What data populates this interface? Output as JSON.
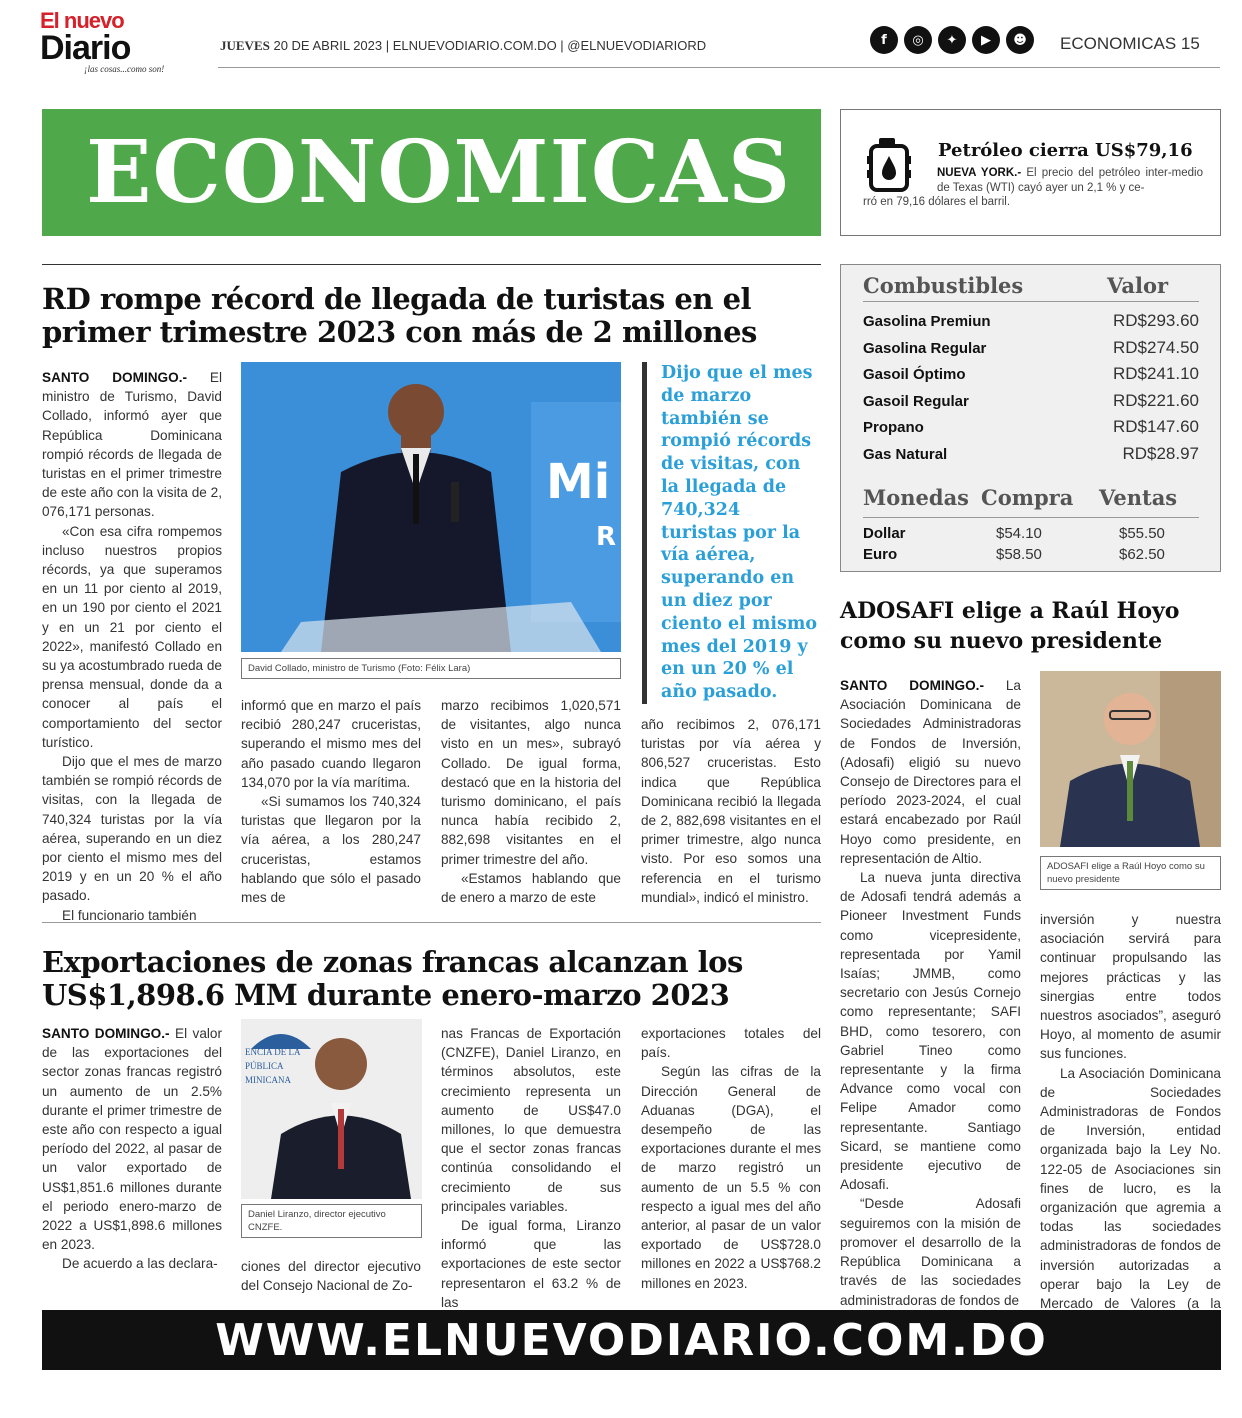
{
  "masthead": {
    "logo_line1": "El nuevo",
    "logo_line2": "Diario",
    "logo_tagline": "¡las cosas...como son!",
    "day": "JUEVES",
    "dateline": " 20 DE ABRIL 2023 | ELNUEVODIARIO.COM.DO | @ELNUEVODIARIORD",
    "section": "ECONOMICAS 15",
    "social_icons": [
      "facebook-icon",
      "instagram-icon",
      "twitter-icon",
      "youtube-icon",
      "snapchat-icon"
    ]
  },
  "banner": {
    "title": "ECONOMICAS",
    "color": "#4fa84a"
  },
  "oil": {
    "headline": "Petróleo cierra US$79,16",
    "dateline": "NUEVA YORK.-",
    "body_a": "El precio del petróleo inter-medio de Texas (WTI) cayó ayer un 2,1 % y ce-",
    "body_b": "rró en 79,16 dólares el barril."
  },
  "fuel": {
    "header_name": "Combustibles",
    "header_value": "Valor",
    "items": [
      {
        "name": "Gasolina Premiun",
        "value": "RD$293.60"
      },
      {
        "name": "Gasolina Regular",
        "value": "RD$274.50"
      },
      {
        "name": "Gasoil Óptimo",
        "value": "RD$241.10"
      },
      {
        "name": "Gasoil Regular",
        "value": "RD$221.60"
      },
      {
        "name": "Propano",
        "value": "RD$147.60"
      },
      {
        "name": "Gas Natural",
        "value": "RD$28.97"
      }
    ],
    "currency_header": "Monedas",
    "buy_header": "Compra",
    "sell_header": "Ventas",
    "currencies": [
      {
        "name": "Dollar",
        "buy": "$54.10",
        "sell": "$55.50"
      },
      {
        "name": "Euro",
        "buy": "$58.50",
        "sell": "$62.50"
      }
    ]
  },
  "article1": {
    "headline_1": "RD rompe récord de llegada de turistas en el",
    "headline_2": "primer trimestre 2023 con más de 2 millones",
    "lead": "SANTO DOMINGO.-",
    "col1": "El ministro de Turismo, David Collado, informó ayer que República Dominicana rompió récords de llegada de turistas en el primer trimestre de este año con la visita de 2, 076,171 personas.\n«Con esa cifra rompemos incluso nuestros propios récords, ya que superamos en un 11 por ciento al 2019, en un 190 por ciento el 2021 y en un 21 por ciento el 2022», manifestó Collado en su ya acostumbrado rueda de prensa mensual, donde da a conocer al país el comportamiento del sector turístico.\nDijo que el mes de marzo también se rompió récords de visitas, con la llegada de 740,324 turistas por la vía aérea, superando en un diez por ciento el mismo mes del 2019 y en un 20 % el año pasado.\nEl funcionario también",
    "col2": "informó que en marzo el país recibió 280,247 cruceristas, superando el mismo mes del año pasado cuando llegaron 134,070 por la vía marítima.\n«Si sumamos los 740,324 turistas que llegaron por la vía aérea, a los 280,247 cruceristas, estamos hablando que sólo el pasado mes de",
    "col3": "marzo recibimos 1,020,571 de visitantes, algo nunca visto en un mes», subrayó Collado. De igual forma, destacó que en la historia del turismo dominicano, el país nunca había recibido 2, 882,698 visitantes en el primer trimestre del año.\n«Estamos hablando que de enero a marzo de este",
    "col4": "año recibimos 2, 076,171 turistas por vía aérea y 806,527 cruceristas. Esto indica que República Dominicana recibió la llegada de 2, 882,698 visitantes en el primer trimestre, algo nunca visto. Por eso somos una referencia en el turismo mundial», indicó el ministro.",
    "photo_caption": "David Collado, ministro de Turismo (Foto: Félix Lara)",
    "photo_text_1": "Mi",
    "photo_text_2": "R",
    "pullquote": "Dijo que el mes de marzo también se rompió récords de visitas, con la llegada de 740,324 turistas por la vía aérea, superando en un diez por ciento el mismo mes del 2019 y en un 20 % el año pasado."
  },
  "article2": {
    "headline_1": "ADOSAFI elige a Raúl Hoyo",
    "headline_2": "como su nuevo presidente",
    "lead": "SANTO DOMINGO.-",
    "col1": "La Asociación Dominicana de Sociedades Administradoras de Fondos de Inversión, (Adosafi) eligió su nuevo Consejo de Directores para el período 2023-2024, el cual estará encabezado por Raúl Hoyo como presidente, en representación de Altio.\nLa nueva junta directiva de Adosafi tendrá además a Pioneer Investment Funds como vicepresidente, representada por Yamil Isaías; JMMB, como secretario con Jesús Cornejo como representante; SAFI BHD, como tesorero, con Gabriel Tineo como representante y la firma Advance como vocal con Felipe Amador como representante. Santiago Sicard, se mantiene como presidente ejecutivo de Adosafi.\n“Desde Adosafi seguiremos con la misión de promover el desarrollo de la República Dominicana a través de las sociedades administradoras de fondos de",
    "col2": "inversión y nuestra asociación servirá para continuar propulsando las mejores prácticas y las sinergias entre todos nuestros asociados”, aseguró Hoyo, al momento de asumir sus funciones.\nLa Asociación Dominicana de Sociedades Administradoras de Fondos de Inversión, entidad organizada bajo la Ley No. 122-05 de Asociaciones sin fines de lucro, es la organización que agremia a todas las sociedades administradoras de fondos de inversión autorizadas a operar bajo la Ley de Mercado de Valores (a la fecha diez administradoras).",
    "photo_caption": "ADOSAFI elige a Raúl Hoyo como su nuevo presidente"
  },
  "article3": {
    "headline_1": "Exportaciones de zonas francas alcanzan los",
    "headline_2": "US$1,898.6 MM durante enero-marzo 2023",
    "lead": "SANTO DOMINGO.-",
    "col1": "El valor de las exportaciones del sector zonas francas registró un aumento de un 2.5% durante el primer trimestre de este año con respecto a igual período del 2022, al pasar de un valor exportado de US$1,851.6 millones durante el periodo enero-marzo de 2022 a US$1,898.6 millones en 2023.\nDe acuerdo a las declara-",
    "col2": "ciones del director ejecutivo del Consejo Nacional de Zo-",
    "col3": "nas Francas de Exportación (CNZFE), Daniel Liranzo, en términos absolutos, este crecimiento representa un aumento de US$47.0 millones, lo que demuestra que el sector zonas francas continúa consolidando el crecimiento de sus principales variables.\nDe igual forma, Liranzo informó que las exportaciones de este sector representaron el 63.2 % de las",
    "col4": "exportaciones totales del país.\nSegún las cifras de la Dirección General de Aduanas (DGA), el desempeño de las exportaciones durante el mes de marzo registró un aumento de un 5.5 % con respecto a igual mes del año anterior, al pasar de un valor exportado de US$728.0 millones en 2022 a US$768.2 millones en 2023.",
    "photo_caption": "Daniel Liranzo, director ejecutivo CNZFE.",
    "photo_text": "ENCIA DE LA PÚBLICA MINICANA"
  },
  "footer": {
    "url": "WWW.ELNUEVODIARIO.COM.DO"
  }
}
